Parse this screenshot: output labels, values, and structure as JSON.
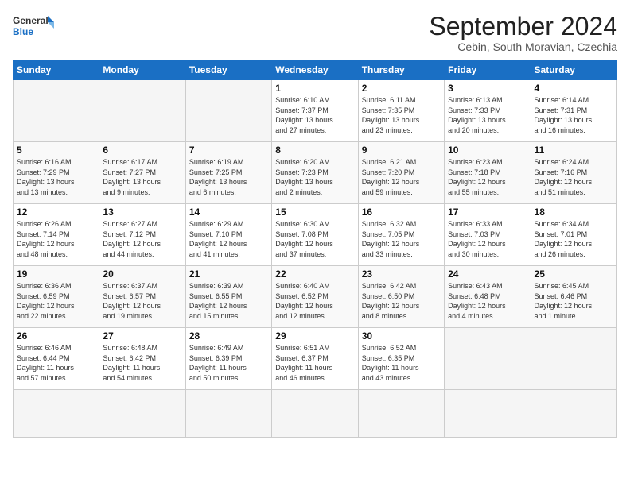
{
  "header": {
    "logo_general": "General",
    "logo_blue": "Blue",
    "month_title": "September 2024",
    "subtitle": "Cebin, South Moravian, Czechia"
  },
  "weekdays": [
    "Sunday",
    "Monday",
    "Tuesday",
    "Wednesday",
    "Thursday",
    "Friday",
    "Saturday"
  ],
  "days": [
    {
      "day": "",
      "info": ""
    },
    {
      "day": "",
      "info": ""
    },
    {
      "day": "",
      "info": ""
    },
    {
      "day": "1",
      "info": "Sunrise: 6:10 AM\nSunset: 7:37 PM\nDaylight: 13 hours\nand 27 minutes."
    },
    {
      "day": "2",
      "info": "Sunrise: 6:11 AM\nSunset: 7:35 PM\nDaylight: 13 hours\nand 23 minutes."
    },
    {
      "day": "3",
      "info": "Sunrise: 6:13 AM\nSunset: 7:33 PM\nDaylight: 13 hours\nand 20 minutes."
    },
    {
      "day": "4",
      "info": "Sunrise: 6:14 AM\nSunset: 7:31 PM\nDaylight: 13 hours\nand 16 minutes."
    },
    {
      "day": "5",
      "info": "Sunrise: 6:16 AM\nSunset: 7:29 PM\nDaylight: 13 hours\nand 13 minutes."
    },
    {
      "day": "6",
      "info": "Sunrise: 6:17 AM\nSunset: 7:27 PM\nDaylight: 13 hours\nand 9 minutes."
    },
    {
      "day": "7",
      "info": "Sunrise: 6:19 AM\nSunset: 7:25 PM\nDaylight: 13 hours\nand 6 minutes."
    },
    {
      "day": "8",
      "info": "Sunrise: 6:20 AM\nSunset: 7:23 PM\nDaylight: 13 hours\nand 2 minutes."
    },
    {
      "day": "9",
      "info": "Sunrise: 6:21 AM\nSunset: 7:20 PM\nDaylight: 12 hours\nand 59 minutes."
    },
    {
      "day": "10",
      "info": "Sunrise: 6:23 AM\nSunset: 7:18 PM\nDaylight: 12 hours\nand 55 minutes."
    },
    {
      "day": "11",
      "info": "Sunrise: 6:24 AM\nSunset: 7:16 PM\nDaylight: 12 hours\nand 51 minutes."
    },
    {
      "day": "12",
      "info": "Sunrise: 6:26 AM\nSunset: 7:14 PM\nDaylight: 12 hours\nand 48 minutes."
    },
    {
      "day": "13",
      "info": "Sunrise: 6:27 AM\nSunset: 7:12 PM\nDaylight: 12 hours\nand 44 minutes."
    },
    {
      "day": "14",
      "info": "Sunrise: 6:29 AM\nSunset: 7:10 PM\nDaylight: 12 hours\nand 41 minutes."
    },
    {
      "day": "15",
      "info": "Sunrise: 6:30 AM\nSunset: 7:08 PM\nDaylight: 12 hours\nand 37 minutes."
    },
    {
      "day": "16",
      "info": "Sunrise: 6:32 AM\nSunset: 7:05 PM\nDaylight: 12 hours\nand 33 minutes."
    },
    {
      "day": "17",
      "info": "Sunrise: 6:33 AM\nSunset: 7:03 PM\nDaylight: 12 hours\nand 30 minutes."
    },
    {
      "day": "18",
      "info": "Sunrise: 6:34 AM\nSunset: 7:01 PM\nDaylight: 12 hours\nand 26 minutes."
    },
    {
      "day": "19",
      "info": "Sunrise: 6:36 AM\nSunset: 6:59 PM\nDaylight: 12 hours\nand 22 minutes."
    },
    {
      "day": "20",
      "info": "Sunrise: 6:37 AM\nSunset: 6:57 PM\nDaylight: 12 hours\nand 19 minutes."
    },
    {
      "day": "21",
      "info": "Sunrise: 6:39 AM\nSunset: 6:55 PM\nDaylight: 12 hours\nand 15 minutes."
    },
    {
      "day": "22",
      "info": "Sunrise: 6:40 AM\nSunset: 6:52 PM\nDaylight: 12 hours\nand 12 minutes."
    },
    {
      "day": "23",
      "info": "Sunrise: 6:42 AM\nSunset: 6:50 PM\nDaylight: 12 hours\nand 8 minutes."
    },
    {
      "day": "24",
      "info": "Sunrise: 6:43 AM\nSunset: 6:48 PM\nDaylight: 12 hours\nand 4 minutes."
    },
    {
      "day": "25",
      "info": "Sunrise: 6:45 AM\nSunset: 6:46 PM\nDaylight: 12 hours\nand 1 minute."
    },
    {
      "day": "26",
      "info": "Sunrise: 6:46 AM\nSunset: 6:44 PM\nDaylight: 11 hours\nand 57 minutes."
    },
    {
      "day": "27",
      "info": "Sunrise: 6:48 AM\nSunset: 6:42 PM\nDaylight: 11 hours\nand 54 minutes."
    },
    {
      "day": "28",
      "info": "Sunrise: 6:49 AM\nSunset: 6:39 PM\nDaylight: 11 hours\nand 50 minutes."
    },
    {
      "day": "29",
      "info": "Sunrise: 6:51 AM\nSunset: 6:37 PM\nDaylight: 11 hours\nand 46 minutes."
    },
    {
      "day": "30",
      "info": "Sunrise: 6:52 AM\nSunset: 6:35 PM\nDaylight: 11 hours\nand 43 minutes."
    },
    {
      "day": "",
      "info": ""
    },
    {
      "day": "",
      "info": ""
    },
    {
      "day": "",
      "info": ""
    },
    {
      "day": "",
      "info": ""
    },
    {
      "day": "",
      "info": ""
    }
  ]
}
